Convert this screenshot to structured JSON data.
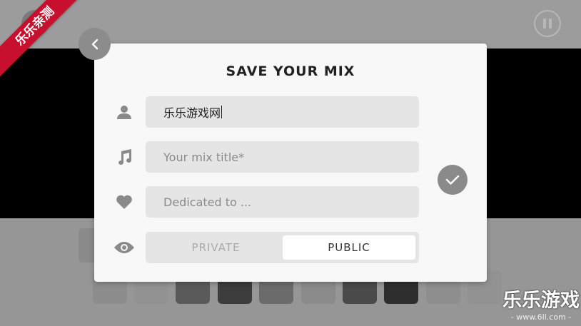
{
  "dialog": {
    "title": "SAVE YOUR MIX",
    "name_value": "乐乐游戏网",
    "title_placeholder": "Your mix title*",
    "dedication_placeholder": "Dedicated to ...",
    "visibility": {
      "options": [
        "PRIVATE",
        "PUBLIC"
      ],
      "selected": "PUBLIC"
    }
  },
  "icons": {
    "back": "chevron-left-icon",
    "user": "user-icon",
    "music": "music-note-icon",
    "heart": "heart-icon",
    "eye": "eye-icon",
    "confirm": "checkmark-icon",
    "pause": "pause-icon"
  },
  "overlay": {
    "ribbon_text": "乐乐亲测",
    "watermark_title": "乐乐游戏",
    "watermark_url": "- www.6ll.com -"
  },
  "colors": {
    "dialog_bg": "#f8f8f8",
    "field_bg": "#e5e5e5",
    "confirm_bg": "#8a8a8a",
    "ribbon": "#c8102e"
  }
}
